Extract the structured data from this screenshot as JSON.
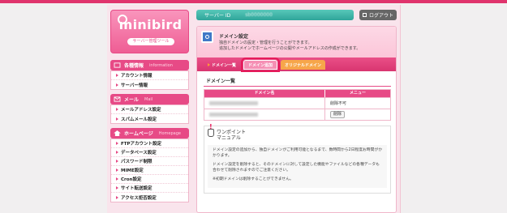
{
  "brand": {
    "logo_text": "minibird",
    "logo_sub": "サーバー管理ツール"
  },
  "header": {
    "server_label": "サーバー ID",
    "server_id": "sb0000000",
    "logout_label": "ログアウト"
  },
  "sidebar": {
    "sections": [
      {
        "title": "各種情報",
        "title_en": "information",
        "items": [
          "アカウント情報",
          "サーバー情報"
        ]
      },
      {
        "title": "メール",
        "title_en": "Mail",
        "items": [
          "メールアドレス設定",
          "スパムメール設定"
        ]
      },
      {
        "title": "ホームページ",
        "title_en": "Homepage",
        "items": [
          "FTPアカウント設定",
          "データベース設定",
          "パスワード制限",
          "MIME設定",
          "Cron設定",
          "サイト転送設定",
          "アクセス拒否設定"
        ]
      }
    ]
  },
  "main": {
    "title": "ドメイン設定",
    "desc_line1": "独自ドメインの設定・管理を行うことができます。",
    "desc_line2": "追加したドメインでホームページの公開やメールアドレスの作成ができます。",
    "tabs": [
      "ドメイン一覧",
      "ドメイン追加",
      "オリジナルドメイン"
    ],
    "list_title": "ドメイン一覧",
    "table": {
      "col_domain": "ドメイン名",
      "col_menu": "メニュー",
      "rows": [
        {
          "menu": "削除不可"
        },
        {
          "menu": "削除"
        }
      ]
    },
    "tip": {
      "title_line1": "ワンポイント",
      "title_line2": "マニュアル",
      "p1": "ドメイン設定の追加から、独自ドメインがご利用可能となるまで、数時間から2日程度お時間がかかります。",
      "p2": "ドメイン設定を削除すると、そのドメインに対して設定した機能やファイルなどの各種データも合わせて削除されますのでご注意ください。",
      "p3": "※初期ドメインは削除することができません。"
    }
  },
  "colors": {
    "accent": "#e74a86",
    "teal": "#2fa59a",
    "highlight": "#e61a5a"
  }
}
